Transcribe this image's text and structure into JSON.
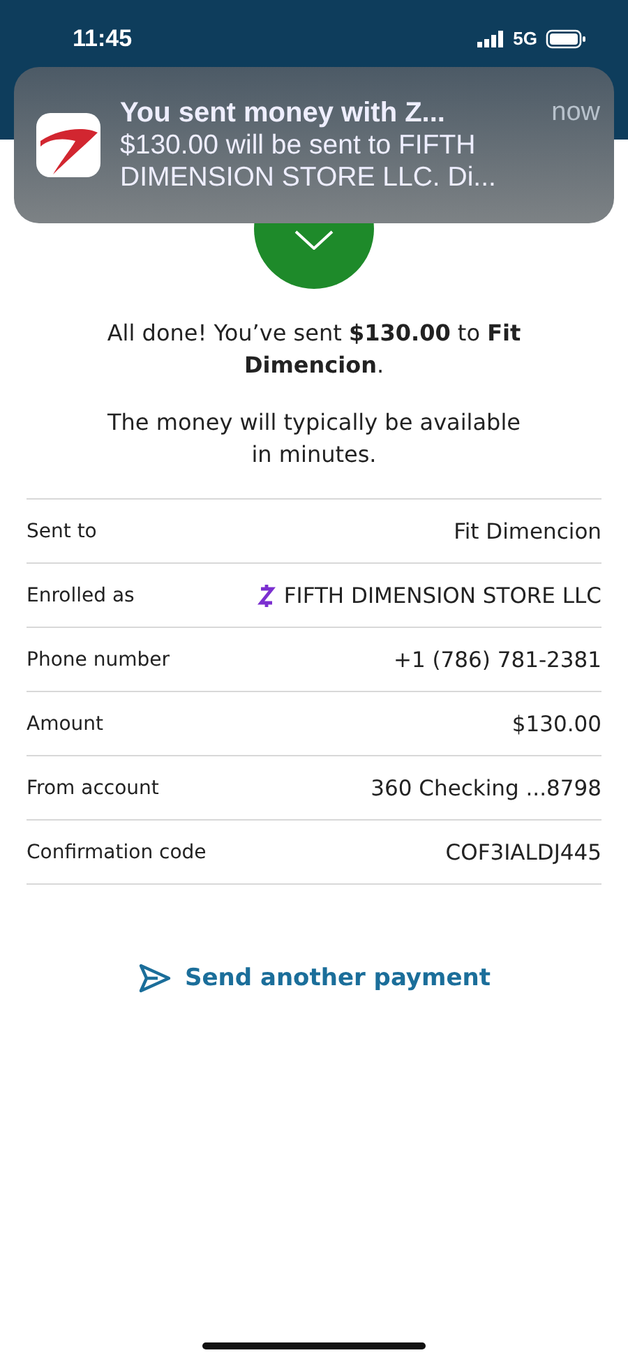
{
  "status_bar": {
    "time": "11:45",
    "network": "5G"
  },
  "notification": {
    "title": "You sent money with Z...",
    "time": "now",
    "body": "$130.00 will be sent to FIFTH DIMENSION STORE LLC. Di..."
  },
  "message": "All done! You’ve sent **$130.00** to **Fit Dimencion**.",
  "note": "The money will typically be available in minutes.",
  "details": [
    {
      "kind": "plain",
      "label": "Sent to",
      "value": "Fit Dimencion"
    },
    {
      "kind": "zelle",
      "label": "Enrolled as",
      "value": "FIFTH DIMENSION STORE LLC"
    },
    {
      "kind": "plain",
      "label": "Phone number",
      "value": "+1 (786) 781-2381"
    },
    {
      "kind": "plain",
      "label": "Amount",
      "value": "$130.00"
    },
    {
      "kind": "plain",
      "label": "From account",
      "value": "360 Checking ...8798"
    },
    {
      "kind": "plain",
      "label": "Confirmation code",
      "value": "COF3IALDJ445"
    }
  ],
  "action": "Send another payment"
}
